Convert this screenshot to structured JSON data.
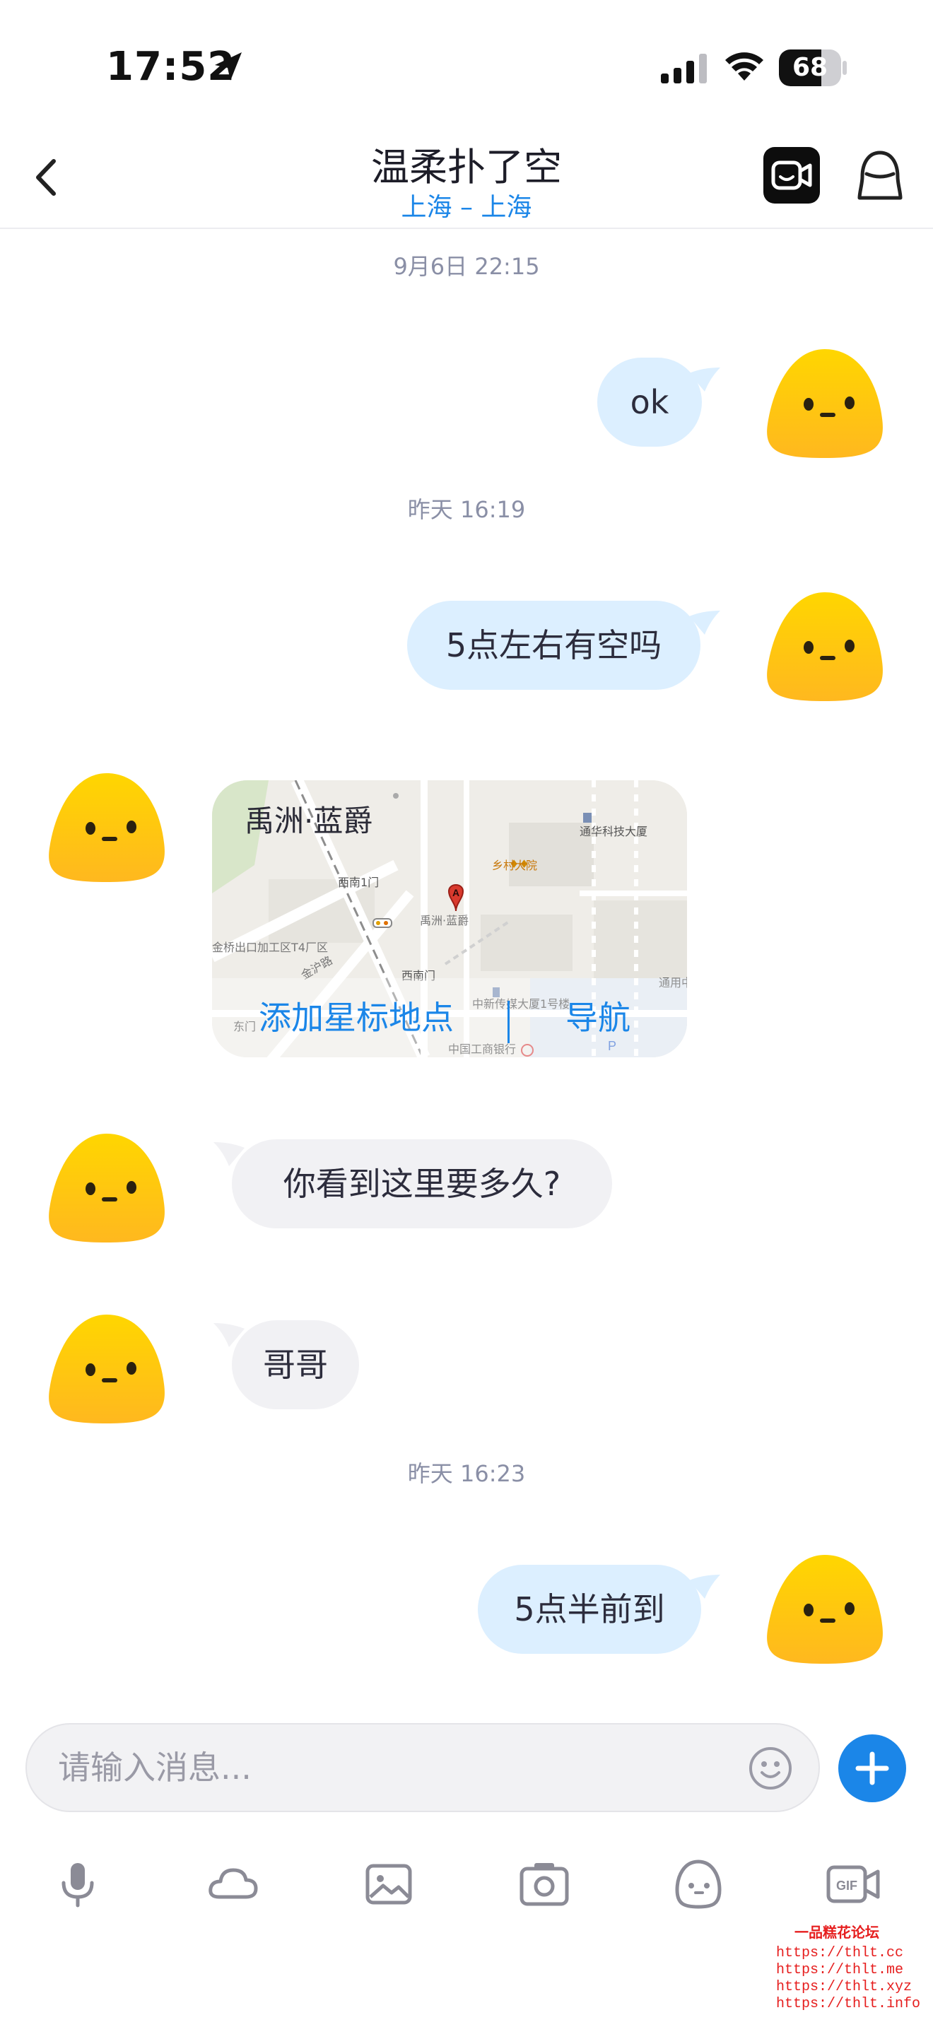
{
  "status_bar": {
    "time": "17:52",
    "battery": "68",
    "battery_level": 0.68
  },
  "header": {
    "title": "温柔扑了空",
    "subtitle": "上海 – 上海"
  },
  "messages": {
    "time_1": "9月6日 22:15",
    "msg_1": "ok",
    "time_2": "昨天 16:19",
    "msg_2": "5点左右有空吗",
    "location": {
      "name": "禹洲·蓝爵",
      "add_star": "添加星标地点",
      "navigate": "导航",
      "labels": {
        "tongtong": "通华科技大厦",
        "xiangcun": "乡村大院",
        "ximen1": "西南1门",
        "yuzhou": "禹洲·蓝爵",
        "jinqiao": "金桥出口加工区T4厂区",
        "ximenmen": "西南门",
        "zhongxin": "中新传媒大厦1号楼",
        "gonghang": "中国工商银行",
        "tongyong": "通用中限公司",
        "jinhu": "金沪路",
        "dongmen": "东门"
      }
    },
    "msg_3": "你看到这里要多久?",
    "msg_4": "哥哥",
    "time_3": "昨天 16:23",
    "msg_5": "5点半前到"
  },
  "input": {
    "placeholder": "请输入消息..."
  },
  "toolbar": {
    "icons": [
      "microphone-icon",
      "cloud-icon",
      "image-icon",
      "camera-icon",
      "sticker-icon",
      "gif-icon"
    ]
  },
  "watermark": {
    "logo": "一品糕花论坛",
    "url_1": "https://thlt.cc",
    "url_2": "https://thlt.me",
    "url_3": "https://thlt.xyz",
    "url_4": "https://thlt.info"
  },
  "colors": {
    "accent": "#1b86e8",
    "outgoing_bubble": "#dcefff",
    "incoming_bubble": "#f1f1f4",
    "avatar_yellow": "#ffcc00"
  }
}
